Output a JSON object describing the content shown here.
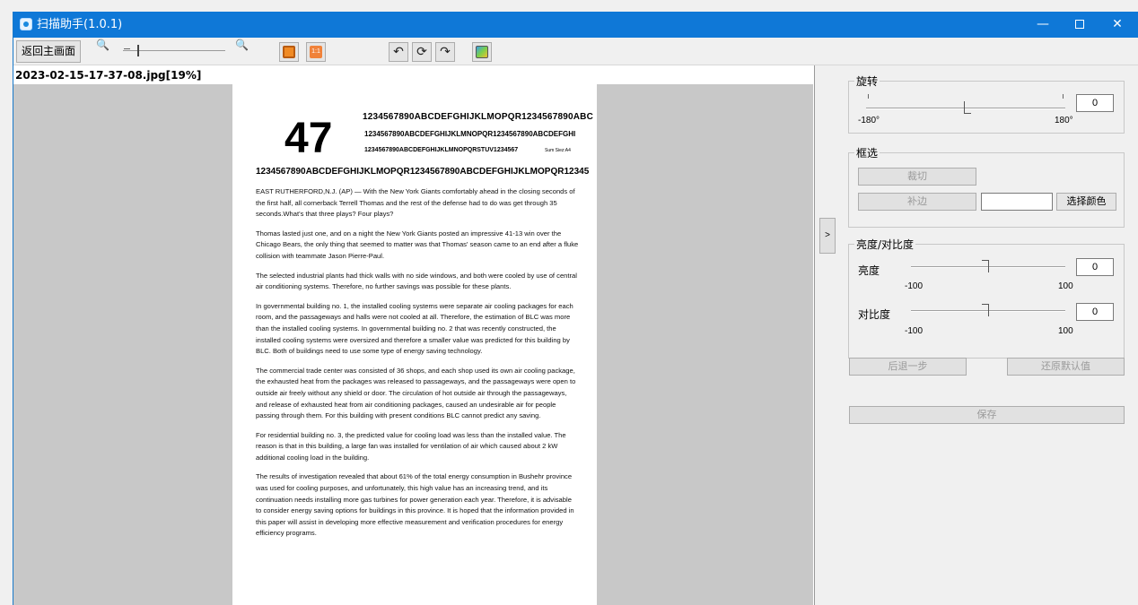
{
  "window": {
    "title": "扫描助手(1.0.1)",
    "minimize_glyph": "—",
    "close_glyph": "✕"
  },
  "toolbar": {
    "home_label": "返回主画面",
    "zoom_out_glyph": "🔍",
    "zoom_in_glyph": "🔍",
    "icons": [
      "fit-icon",
      "actual-size-icon",
      "rotate-left-icon",
      "rotate-reset-icon",
      "rotate-right-icon",
      "color-icon"
    ],
    "fit_color": "#f08a24",
    "actual_size_color": "#f0823a",
    "actual_size_text": "1:1",
    "rotate_left_glyph": "↶",
    "rotate_reset_glyph": "⟳",
    "rotate_right_glyph": "↷"
  },
  "viewer": {
    "filename": "2023-02-15-17-37-08.jpg[19%]",
    "document": {
      "big_number": "47",
      "header_line1": "1234567890ABCDEFGHIJKLMOPQR1234567890ABC",
      "header_line2": "1234567890ABCDEFGHIJKLMNOPQR1234567890ABCDEFGHI",
      "header_line3": "1234567890ABCDEFGHIJKLMNOPQRSTUV1234567",
      "header_line3_tail": "Sum Siez:A4",
      "header_line4": "1234567890ABCDEFGHIJKLMOPQR1234567890ABCDEFGHIJKLMOPQR12345",
      "paragraphs": [
        "EAST RUTHERFORD,N.J. (AP) — With the New York Giants comfortably ahead in the closing seconds of the first half, all cornerback Terrell Thomas and the rest of the defense had to do was get through 35 seconds.What's that three plays? Four plays?",
        "Thomas lasted just one, and on a night the New York Giants posted an impressive 41-13 win over the Chicago Bears, the only thing that seemed to matter was that Thomas' season came to an end after a fluke collision with teammate Jason Pierre-Paul.",
        "The selected industrial plants had thick walls with no side windows, and both were cooled by use of central air conditioning systems. Therefore, no further savings was possible for these plants.",
        "In governmental building no. 1, the installed cooling systems were separate air cooling packages for each room, and the passageways and halls were not cooled at all. Therefore, the estimation of BLC was more than the installed cooling systems. In governmental building no. 2 that was recently constructed, the installed cooling systems were oversized and therefore a smaller value was predicted for this building by BLC. Both of buildings need to use some type of energy saving technology.",
        "The commercial trade center was consisted of 36 shops, and each shop used its own air cooling package, the exhausted heat from the packages was released to passageways, and the passageways were open to outside air freely without any shield or door. The circulation of hot outside air through the passageways, and release of exhausted heat from air conditioning packages, caused an undesirable air for people passing through them. For this building with present conditions BLC cannot predict any saving.",
        "For residential building no. 3, the predicted value for cooling load was less than the installed value. The reason is that in this building, a large fan was installed for ventilation of air which caused about 2 kW additional cooling load in the building.",
        "The results of investigation revealed that about 61% of the total energy consumption in Bushehr province was used for cooling purposes, and unfortunately, this high value has an increasing trend, and its continuation needs installing more gas turbines for power generation each year. Therefore, it is advisable to consider energy saving options for buildings in this province. It is hoped that the information provided in this paper will assist in developing more effective measurement and verification procedures for energy efficiency programs."
      ]
    }
  },
  "panel": {
    "collapse_glyph": ">",
    "rotate": {
      "label": "旋转",
      "value": "0",
      "min_label": "-180°",
      "max_label": "180°",
      "level_fraction": 0.5
    },
    "crop": {
      "label": "框选",
      "crop_button": "裁切",
      "pad_button": "补边",
      "pick_color_button": "选择颜色"
    },
    "brightness_contrast": {
      "label": "亮度/对比度",
      "brightness_label": "亮度",
      "brightness_value": "0",
      "brightness_min": "-100",
      "brightness_max": "100",
      "contrast_label": "对比度",
      "contrast_value": "0",
      "contrast_min": "-100",
      "contrast_max": "100"
    },
    "undo_button": "后退一步",
    "reset_button": "还原默认值",
    "save_button": "保存"
  }
}
